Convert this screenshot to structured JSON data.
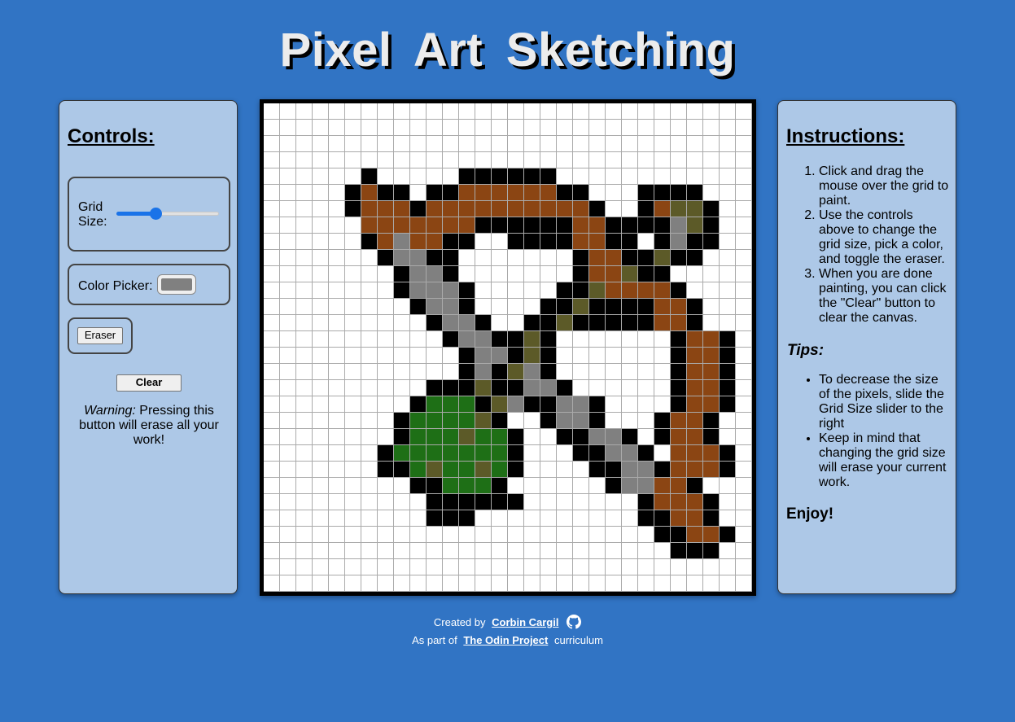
{
  "page": {
    "title": "Pixel Art Sketching"
  },
  "controls": {
    "heading": "Controls:",
    "grid_size_label": "Grid Size:",
    "grid_size_level": 0.38,
    "color_picker_label": "Color Picker:",
    "selected_color": "#808080",
    "eraser_label": "Eraser",
    "clear_label": "Clear",
    "warning_prefix": "Warning:",
    "warning_text": " Pressing this button will erase all your work!"
  },
  "instructions": {
    "heading": "Instructions:",
    "steps": [
      "Click and drag the mouse over the grid to paint.",
      "Use the controls above to change the grid size, pick a color, and toggle the eraser.",
      "When you are done painting, you can click the \"Clear\" button to clear the canvas."
    ],
    "tips_heading": "Tips:",
    "tips": [
      "To decrease the size of the pixels, slide the Grid Size slider to the right",
      "Keep in mind that changing the grid size will erase your current work."
    ],
    "closing": "Enjoy!"
  },
  "canvas": {
    "cells_per_side": 30,
    "palette": {
      "K": "#000000",
      "B": "#8b4513",
      "G": "#808080",
      "O": "#5c5a28",
      "R": "#1e6f16"
    },
    "rows": [
      "..............................",
      "..............................",
      "..............................",
      "..............................",
      "......K.....KKKKKK............",
      ".....KBKK.KKBBBBBBKK...KKKK...",
      ".....KBBBKBBBBBBBBBBK..KBOOK..",
      "......BBBBBBBKKKKKKBBKKKKGOK..",
      "......KBGBBKK..KKKKBBKK.KGKK..",
      ".......KGGKK.......KBBKKOKK...",
      "........KGGK.......KBBOKK.....",
      "........KGGGK.....KKOBBBBK....",
      ".........KGGK....KKOKKKKBBK...",
      "..........KGGK..KKOKKKKKBBK...",
      "...........KGGKKOK.......KBBK.",
      "............KGGKOK.......KBBK.",
      "............KGKOGK.......KBBK.",
      "..........KKKOKKGGK......KBBK.",
      ".........KRRRKOGKKGGK....KBBK.",
      "........KRRRROK..KGGK...KBBK..",
      "........KRRRORRK..KKGGK.KBBK..",
      ".......KRRRRRRRK...KKGGK.BBBK.",
      ".......KKRORRORK....KKGGKBBBK.",
      ".........KKRRRK......KGGBBK...",
      "..........KKKKKK.......KBBBK..",
      "..........KKK..........KKBBK..",
      "........................KKBBK.",
      ".........................KKK..",
      "..............................",
      ".............................."
    ]
  },
  "footer": {
    "created_by": "Created by",
    "author": "Corbin Cargil",
    "as_part_of": "As part of",
    "project": "The Odin Project",
    "curriculum": "curriculum"
  },
  "icons": {
    "github": "github-icon"
  }
}
